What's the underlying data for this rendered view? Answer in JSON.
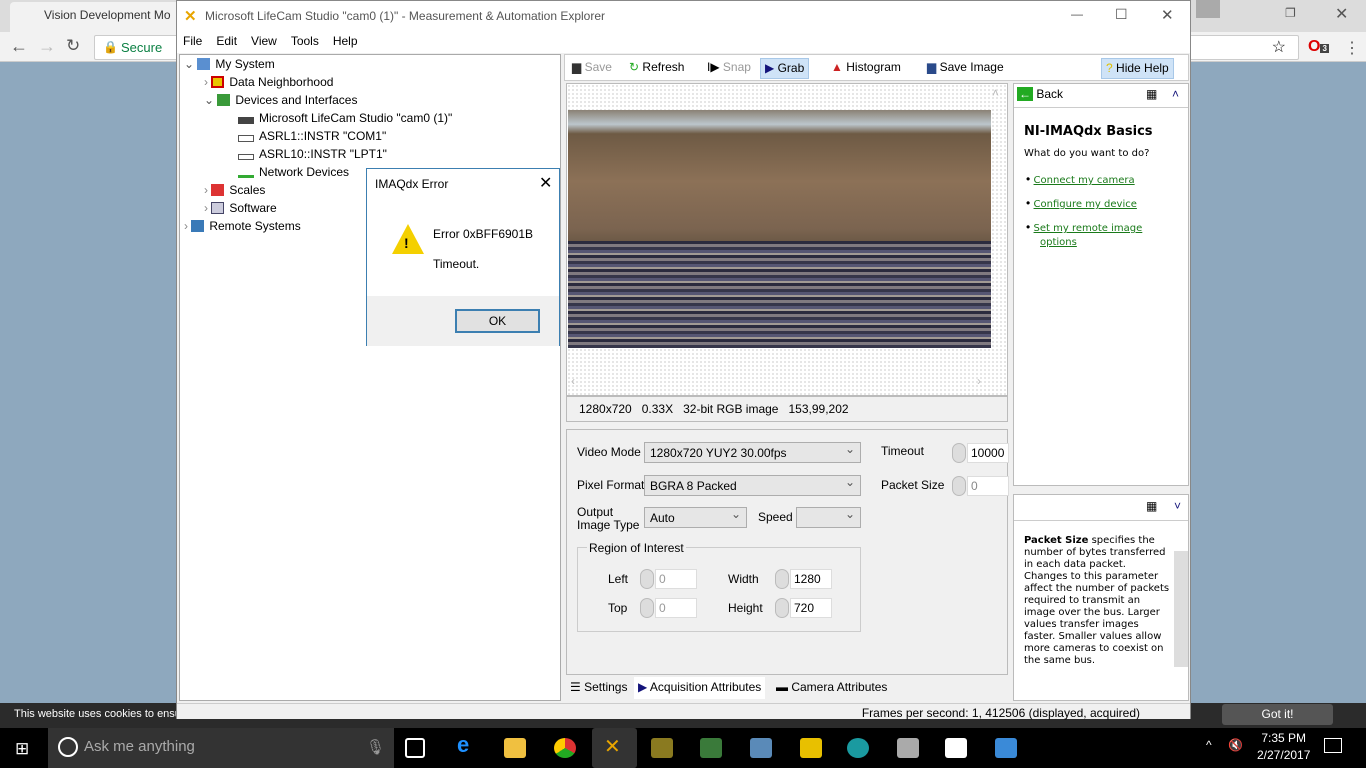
{
  "browser": {
    "tab_title": "Vision Development Mo",
    "secure_label": "Secure",
    "extension_badge": "3"
  },
  "cookie": {
    "text": "This website uses cookies to ensu",
    "button": "Got it!"
  },
  "window": {
    "title": "Microsoft LifeCam Studio  \"cam0 (1)\" - Measurement & Automation Explorer",
    "menu": [
      "File",
      "Edit",
      "View",
      "Tools",
      "Help"
    ]
  },
  "tree": {
    "my_system": "My System",
    "data_neighborhood": "Data Neighborhood",
    "devices": "Devices and Interfaces",
    "camera": "Microsoft LifeCam Studio  \"cam0 (1)\"",
    "asrl1": "ASRL1::INSTR \"COM1\"",
    "asrl10": "ASRL10::INSTR \"LPT1\"",
    "network": "Network Devices",
    "scales": "Scales",
    "software": "Software",
    "remote": "Remote Systems"
  },
  "toolbar": {
    "save": "Save",
    "refresh": "Refresh",
    "snap": "Snap",
    "grab": "Grab",
    "histogram": "Histogram",
    "save_image": "Save Image",
    "hide_help": "Hide Help"
  },
  "image_status": {
    "resolution": "1280x720",
    "zoom": "0.33X",
    "type": "32-bit RGB image",
    "pixel": "153,99,202"
  },
  "settings": {
    "video_mode_label": "Video Mode",
    "video_mode": "1280x720 YUY2 30.00fps",
    "pixel_format_label": "Pixel Format",
    "pixel_format": "BGRA 8 Packed",
    "output_label_1": "Output",
    "output_label_2": "Image Type",
    "output": "Auto",
    "speed_label": "Speed",
    "speed": "",
    "timeout_label": "Timeout",
    "timeout": "10000",
    "packet_label": "Packet Size",
    "packet": "0",
    "roi": {
      "title": "Region of Interest",
      "left_label": "Left",
      "left": "0",
      "top_label": "Top",
      "top": "0",
      "width_label": "Width",
      "width": "1280",
      "height_label": "Height",
      "height": "720"
    }
  },
  "tabs": [
    "Settings",
    "Acquisition Attributes",
    "Camera Attributes"
  ],
  "help": {
    "back": "Back",
    "title": "NI-IMAQdx Basics",
    "question": "What do you want to do?",
    "links": [
      "Connect my camera",
      "Configure my device",
      "Set my remote image options"
    ],
    "packet_term": "Packet Size",
    "packet_text": " specifies the number of bytes transferred in each data packet. Changes to this parameter affect the number of packets required to transmit an image over the bus. Larger values transfer images faster. Smaller values allow more cameras to coexist on the same bus."
  },
  "status": "Frames per second: 1, 412506 (displayed, acquired)",
  "dialog": {
    "title": "IMAQdx Error",
    "error": "Error 0xBFF6901B",
    "message": "Timeout.",
    "ok": "OK"
  },
  "taskbar": {
    "search": "Ask me anything",
    "time": "7:35 PM",
    "date": "2/27/2017"
  }
}
